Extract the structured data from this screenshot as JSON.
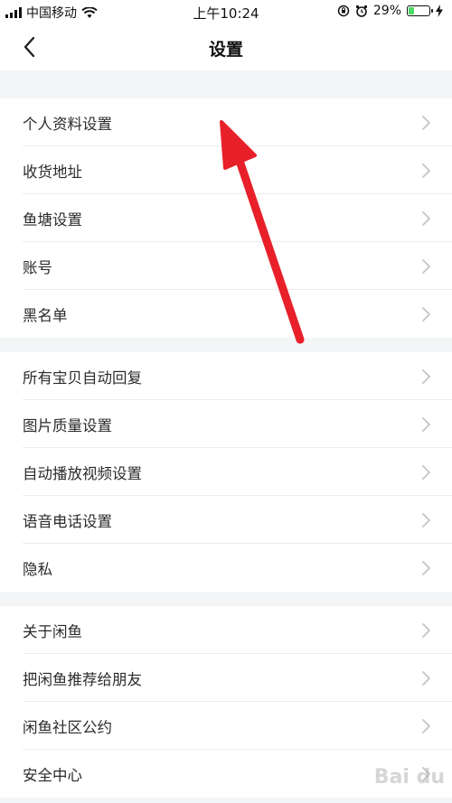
{
  "status_bar": {
    "carrier": "中国移动",
    "time": "上午10:24",
    "battery": "29%",
    "battery_level": 0.29,
    "icons": [
      "signal-icon",
      "wifi-icon",
      "orientation-lock-icon",
      "alarm-icon",
      "battery-icon",
      "charging-icon"
    ]
  },
  "nav": {
    "title": "设置",
    "back_icon": "chevron-left-icon"
  },
  "groups": [
    {
      "items": [
        "个人资料设置",
        "收货地址",
        "鱼塘设置",
        "账号",
        "黑名单"
      ]
    },
    {
      "items": [
        "所有宝贝自动回复",
        "图片质量设置",
        "自动播放视频设置",
        "语音电话设置",
        "隐私"
      ]
    },
    {
      "items": [
        "关于闲鱼",
        "把闲鱼推荐给朋友",
        "闲鱼社区公约",
        "安全中心"
      ]
    }
  ],
  "colors": {
    "annotation_arrow": "#e8202a",
    "background": "#f4f5f7",
    "battery_fill": "#4cd964"
  },
  "watermark": "Bai du"
}
